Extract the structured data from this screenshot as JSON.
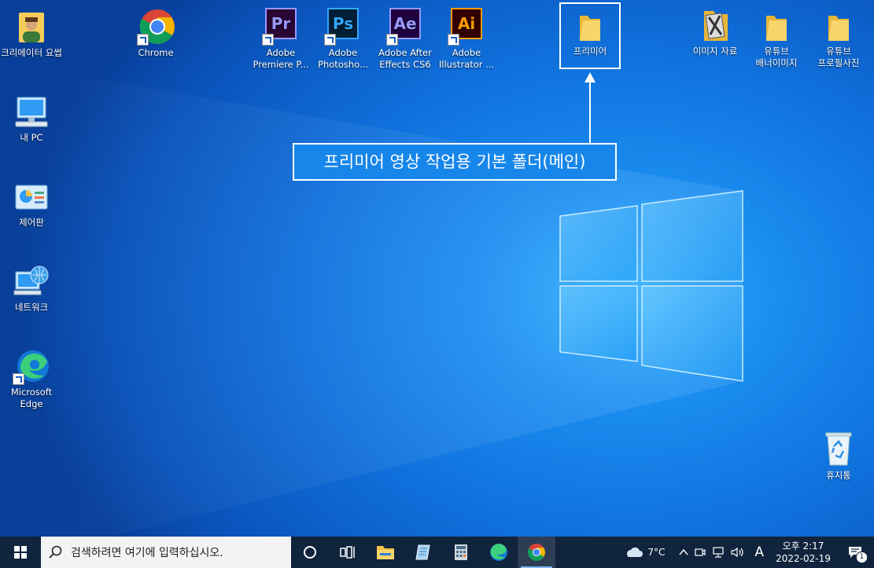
{
  "desktop": {
    "icons": [
      {
        "label": "크리에이터 요썹"
      },
      {
        "label": "Chrome"
      },
      {
        "label": "Adobe Premiere P..."
      },
      {
        "label": "Adobe Photosho..."
      },
      {
        "label": "Adobe After Effects CS6"
      },
      {
        "label": "Adobe Illustrator ..."
      },
      {
        "label": "프리미어"
      },
      {
        "label": "이미지 자료"
      },
      {
        "label": "유튜브 배너이미지"
      },
      {
        "label": "유튜브 프로필사진"
      },
      {
        "label": "내 PC"
      },
      {
        "label": "제어판"
      },
      {
        "label": "네트워크"
      },
      {
        "label": "Microsoft Edge"
      },
      {
        "label": "휴지통"
      }
    ],
    "app_glyphs": {
      "premiere": "Pr",
      "photoshop": "Ps",
      "after_effects": "Ae",
      "illustrator": "Ai"
    },
    "callout_text": "프리미어 영상 작업용 기본 폴더(메인)"
  },
  "taskbar": {
    "search_placeholder": "검색하려면 여기에 입력하십시오.",
    "weather": "7°C",
    "ime": "A",
    "time": "오후 2:17",
    "date": "2022-02-19",
    "notification_count": "1"
  },
  "colors": {
    "premiere": "#9999ff",
    "premiere_bg": "#2a0634",
    "photoshop": "#31a8ff",
    "photoshop_bg": "#001e36",
    "after_effects": "#9999ff",
    "after_effects_bg": "#1f0040",
    "illustrator": "#ff9a00",
    "illustrator_bg": "#330000",
    "folder": "#f6cd5b",
    "taskbar": "#10243d"
  }
}
